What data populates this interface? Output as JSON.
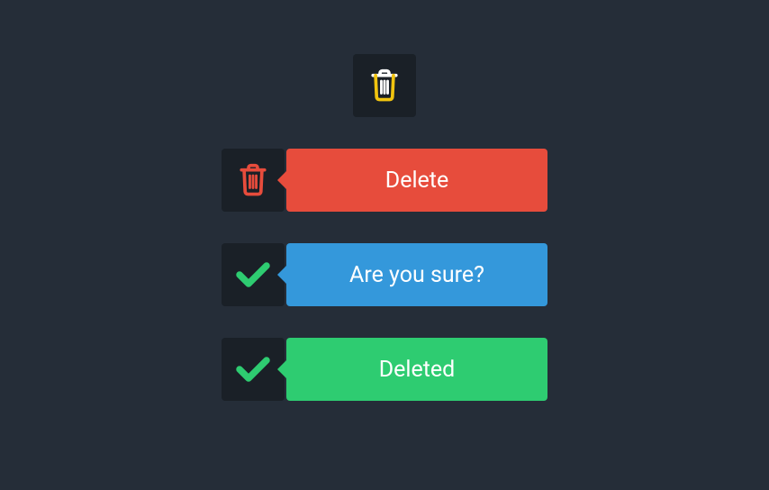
{
  "buttons": {
    "delete": {
      "label": "Delete"
    },
    "confirm": {
      "label": "Are you sure?"
    },
    "done": {
      "label": "Deleted"
    }
  },
  "colors": {
    "bg": "#252D38",
    "iconBox": "#1A2027",
    "red": "#E74C3C",
    "blue": "#3498DB",
    "green": "#2ECC71",
    "white": "#FFFFFF",
    "gold": "#F1C40F"
  }
}
